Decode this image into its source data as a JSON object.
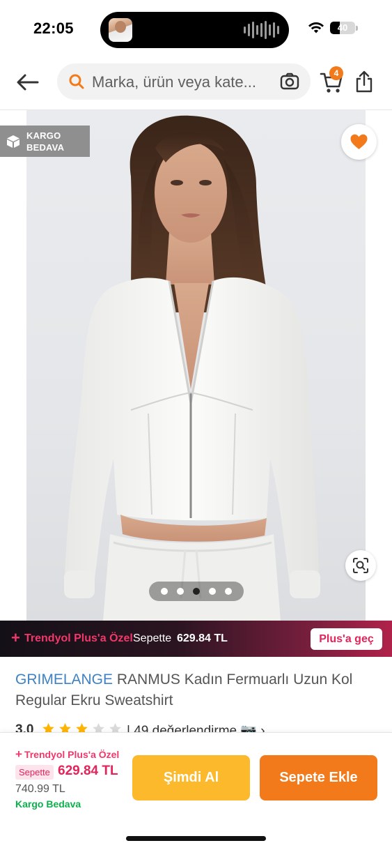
{
  "status_bar": {
    "time": "22:05",
    "battery_level": "40",
    "battery_fraction": 0.4
  },
  "header": {
    "search_placeholder": "Marka, ürün veya kate...",
    "cart_count": "4",
    "icons": [
      "back-arrow-icon",
      "search-icon",
      "camera-icon",
      "cart-icon",
      "share-icon"
    ]
  },
  "gallery": {
    "cargo_badge_line1": "KARGO",
    "cargo_badge_line2": "BEDAVA",
    "image_count": 5,
    "active_image_index": 2,
    "favorited": true
  },
  "plus_banner": {
    "plus_sign": "+",
    "title": "Trendyol Plus'a Özel",
    "basket_label": "Sepette",
    "basket_price": "629.84 TL",
    "cta_label": "Plus'a geç"
  },
  "product": {
    "brand": "GRIMELANGE",
    "name": "RANMUS Kadın Fermuarlı Uzun Kol Regular Ekru Sweatshirt",
    "rating": "3.0",
    "rating_value": 3,
    "rating_max": 5,
    "reviews_text": "| 49 değerlendirme 📷 ›"
  },
  "bottom_bar": {
    "plus_sign": "+",
    "plus_title": "Trendyol Plus'a Özel",
    "basket_label": "Sepette",
    "basket_price": "629.84 TL",
    "old_price": "740.99 TL",
    "shipping": "Kargo Bedava",
    "buy_now_label": "Şimdi Al",
    "add_to_cart_label": "Sepete Ekle"
  },
  "colors": {
    "brand_orange": "#f27a1a",
    "buy_now_yellow": "#fbb92b",
    "plus_pink": "#e3245a",
    "brand_link_blue": "#3f82c4",
    "shipping_green": "#0bb14a"
  }
}
